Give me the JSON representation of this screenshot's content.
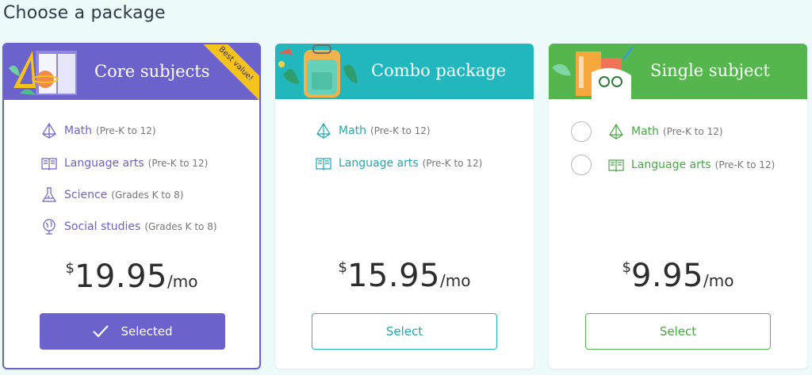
{
  "page": {
    "title": "Choose a package"
  },
  "packages": [
    {
      "title": "Core subjects",
      "ribbon": "Best value!",
      "subjects": [
        {
          "name": "Math",
          "range": "(Pre-K to 12)",
          "icon": "pyramid-icon"
        },
        {
          "name": "Language arts",
          "range": "(Pre-K to 12)",
          "icon": "book-icon"
        },
        {
          "name": "Science",
          "range": "(Grades K to 8)",
          "icon": "flask-icon"
        },
        {
          "name": "Social studies",
          "range": "(Grades K to 8)",
          "icon": "globe-icon"
        }
      ],
      "price": {
        "currency": "$",
        "amount": "19.95",
        "period": "/mo"
      },
      "button": "Selected",
      "selected": true,
      "color": "#6c62cc"
    },
    {
      "title": "Combo package",
      "subjects": [
        {
          "name": "Math",
          "range": "(Pre-K to 12)",
          "icon": "pyramid-icon"
        },
        {
          "name": "Language arts",
          "range": "(Pre-K to 12)",
          "icon": "book-icon"
        }
      ],
      "price": {
        "currency": "$",
        "amount": "15.95",
        "period": "/mo"
      },
      "button": "Select",
      "selected": false,
      "color": "#22b6bd"
    },
    {
      "title": "Single subject",
      "subjects": [
        {
          "name": "Math",
          "range": "(Pre-K to 12)",
          "icon": "pyramid-icon"
        },
        {
          "name": "Language arts",
          "range": "(Pre-K to 12)",
          "icon": "book-icon"
        }
      ],
      "price": {
        "currency": "$",
        "amount": "9.95",
        "period": "/mo"
      },
      "button": "Select",
      "selected": false,
      "color": "#55b64e"
    }
  ]
}
